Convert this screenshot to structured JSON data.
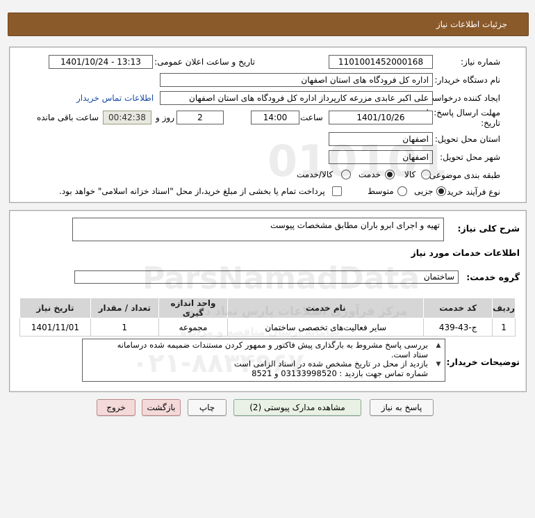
{
  "header": {
    "title": "جزئیات اطلاعات نیاز"
  },
  "info": {
    "need_number_label": "شماره نیاز:",
    "need_number": "1101001452000168",
    "announce_label": "تاریخ و ساعت اعلان عمومی:",
    "announce_value": "1401/10/24 - 13:13",
    "buyer_org_label": "نام دستگاه خریدار:",
    "buyer_org": "اداره کل فرودگاه های استان اصفهان",
    "requester_label": "ایجاد کننده درخواست:",
    "requester": "علی اکبر عابدی مزرعه کارپرداز اداره کل فرودگاه های استان اصفهان",
    "contact_link": "اطلاعات تماس خریدار",
    "deadline_label_1": "مهلت ارسال پاسخ: تا",
    "deadline_label_2": "تاریخ:",
    "deadline_date": "1401/10/26",
    "time_label": "ساعت",
    "deadline_time": "14:00",
    "days": "2",
    "days_label": "روز و",
    "remaining_time": "00:42:38",
    "remaining_label": "ساعت باقی مانده",
    "province_label": "استان محل تحویل:",
    "province": "اصفهان",
    "city_label": "شهر محل تحویل:",
    "city": "اصفهان",
    "category_label": "طبقه بندی موضوعی:",
    "category_options": [
      "کالا",
      "خدمت",
      "کالا/خدمت"
    ],
    "category_selected": "خدمت",
    "process_label": "نوع فرآیند خرید :",
    "process_options": [
      "جزیی",
      "متوسط"
    ],
    "process_selected": "جزیی",
    "payment_note": "پرداخت تمام یا بخشی از مبلغ خرید،از محل \"اسناد خزانه اسلامی\" خواهد بود."
  },
  "details": {
    "desc_label": "شرح کلی نیاز:",
    "desc": "تهیه و اجرای ابرو باران مطابق مشخصات پیوست",
    "services_heading": "اطلاعات خدمات مورد نیاز",
    "group_label": "گروه خدمت:",
    "group_value": "ساختمان",
    "table": {
      "headers": [
        "ردیف",
        "کد خدمت",
        "نام خدمت",
        "واحد اندازه گیری",
        "تعداد / مقدار",
        "تاریخ نیاز"
      ],
      "rows": [
        [
          "1",
          "ج-43-439",
          "سایر فعالیت‌های تخصصی ساختمان",
          "مجموعه",
          "1",
          "1401/11/01"
        ]
      ]
    },
    "notes_label": "توضیحات خریدار:",
    "notes_lines": [
      "بررسی پاسخ مشروط  به بارگذاری پیش فاکتور و ممهور کردن مستندات ضمیمه شده درسامانه",
      "ستاد است.",
      "بازدید از محل در تاریخ مشخص شده در اسناد الزامی است",
      "شماره تماس جهت بازدید : 03133998520 و 8521"
    ]
  },
  "buttons": {
    "reply": "پاسخ به نیاز",
    "attachments": "مشاهده مدارک پیوستی (2)",
    "print": "چاپ",
    "back": "بازگشت",
    "exit": "خروج"
  },
  "watermark": {
    "brand": "ParsNamadData",
    "phone": "۰۲۱-۸۸۳۴۹۶۷۰",
    "number": "010101",
    "company": "مرکز فرآوری اطلاعات پارس نماد داده",
    "sub": "سامانه ارسال مناقصه و مزایده"
  },
  "colors": {
    "title_bar": "#8b5a2b",
    "link": "#1a4aa3",
    "back_button": "#f4d9d9",
    "attachments_button": "#e9f1e4"
  }
}
